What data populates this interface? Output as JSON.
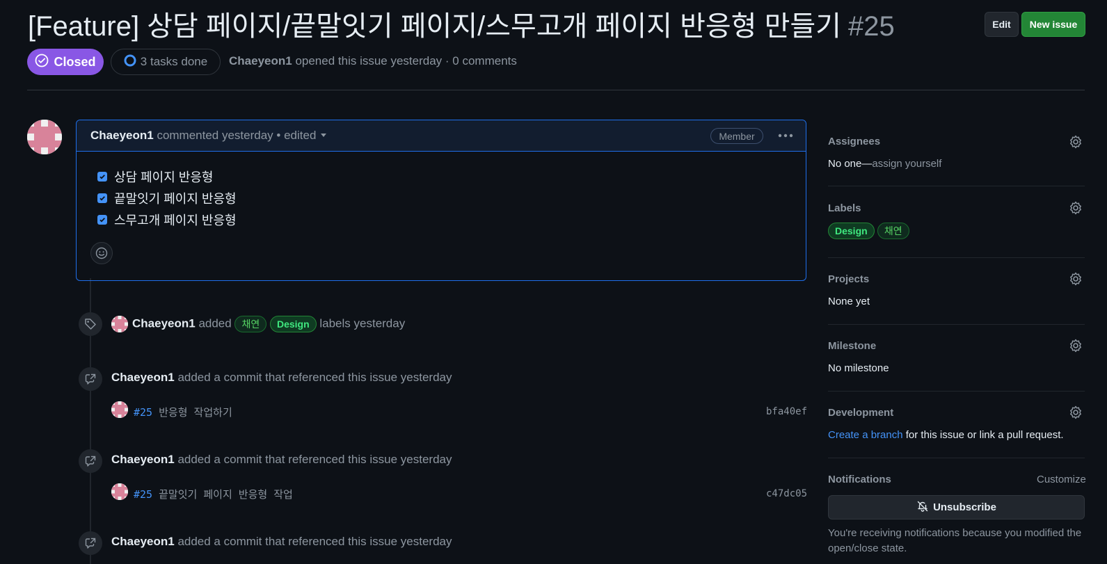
{
  "header": {
    "title": "[Feature] 상담 페이지/끝말잇기 페이지/스무고개 페이지 반응형 만들기",
    "number": "#25",
    "edit_label": "Edit",
    "new_issue_label": "New issue",
    "status": "Closed",
    "tasks": "3 tasks done",
    "opener": "Chaeyeon1",
    "opened_text": "opened this issue yesterday · 0 comments"
  },
  "comment": {
    "author": "Chaeyeon1",
    "meta": "commented yesterday • edited",
    "badge": "Member",
    "tasks": [
      {
        "label": "상담 페이지 반응형",
        "checked": true
      },
      {
        "label": "끝말잇기 페이지 반응형",
        "checked": true
      },
      {
        "label": "스무고개 페이지 반응형",
        "checked": true
      }
    ]
  },
  "timeline": {
    "label_event": {
      "author": "Chaeyeon1",
      "added": "added",
      "labels": [
        "채연",
        "Design"
      ],
      "suffix": "labels yesterday"
    },
    "commit_events": [
      {
        "author": "Chaeyeon1",
        "text": "added a commit that referenced this issue yesterday",
        "ref": "#25",
        "message": "반응형 작업하기",
        "sha": "bfa40ef"
      },
      {
        "author": "Chaeyeon1",
        "text": "added a commit that referenced this issue yesterday",
        "ref": "#25",
        "message": "끝말잇기 페이지 반응형 작업",
        "sha": "c47dc05"
      },
      {
        "author": "Chaeyeon1",
        "text": "added a commit that referenced this issue yesterday"
      }
    ]
  },
  "sidebar": {
    "assignees": {
      "title": "Assignees",
      "value": "No one—",
      "action": "assign yourself"
    },
    "labels": {
      "title": "Labels",
      "items": [
        "Design",
        "채연"
      ]
    },
    "projects": {
      "title": "Projects",
      "value": "None yet"
    },
    "milestone": {
      "title": "Milestone",
      "value": "No milestone"
    },
    "development": {
      "title": "Development",
      "link": "Create a branch",
      "rest": "for this issue or link a pull request."
    },
    "notifications": {
      "title": "Notifications",
      "customize": "Customize",
      "button": "Unsubscribe",
      "note": "You're receiving notifications because you modified the open/close state."
    }
  },
  "colors": {
    "closed": "#8957e5",
    "accent": "#4493f8",
    "new_issue": "#238636"
  },
  "icons": [
    "check-circle-icon",
    "progress-circle-icon",
    "chevron-down-icon",
    "kebab-icon",
    "smiley-icon",
    "tag-icon",
    "cross-reference-icon",
    "gear-icon",
    "bell-slash-icon"
  ]
}
